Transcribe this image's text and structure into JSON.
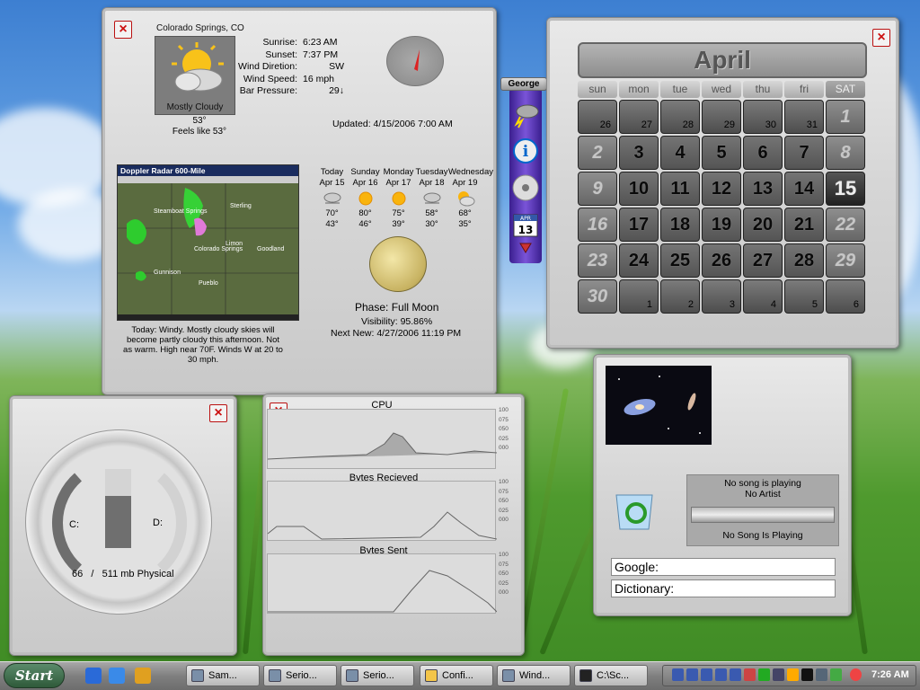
{
  "weather": {
    "city": "Colorado Springs, CO",
    "condition": "Mostly Cloudy",
    "temp": "53°",
    "feels": "Feels like 53°",
    "stats": [
      {
        "label": "Sunrise:",
        "value": "6:23 AM"
      },
      {
        "label": "Sunset:",
        "value": "7:37 PM"
      },
      {
        "label": "Wind Diretion:",
        "value": "SW"
      },
      {
        "label": "Wind Speed:",
        "value": "16  mph"
      },
      {
        "label": "Bar Pressure:",
        "value": "29↓"
      }
    ],
    "updated": "Updated: 4/15/2006 7:00 AM",
    "radar_title": "Doppler Radar 600-Mile",
    "radar_labels": [
      "Steamboat Springs",
      "Colorado Springs",
      "Pueblo",
      "Limon",
      "Goodland",
      "Sterling",
      "Gunnison"
    ],
    "forecast": [
      {
        "day": "Today",
        "date": "Apr 15",
        "hi": "70°",
        "lo": "43°",
        "icon": "windy-icon"
      },
      {
        "day": "Sunday",
        "date": "Apr 16",
        "hi": "80°",
        "lo": "46°",
        "icon": "sun-icon"
      },
      {
        "day": "Monday",
        "date": "Apr 17",
        "hi": "75°",
        "lo": "39°",
        "icon": "sun-icon"
      },
      {
        "day": "Tuesday",
        "date": "Apr 18",
        "hi": "58°",
        "lo": "30°",
        "icon": "windy-icon"
      },
      {
        "day": "Wednesday",
        "date": "Apr 19",
        "hi": "68°",
        "lo": "35°",
        "icon": "partly-sunny-icon"
      }
    ],
    "phase": "Phase: Full Moon",
    "visibility": "Visibility: 95.86%",
    "next_new": "Next New: 4/27/2006 11:19 PM",
    "text_forecast": "Today: Windy. Mostly cloudy skies will become partly cloudy this afternoon. Not as warm. High near 70F. Winds W at 20 to 30 mph."
  },
  "sidebar": {
    "user": "George",
    "calendar_icon_month": "APR",
    "calendar_icon_day": "13"
  },
  "calendar": {
    "month": "April",
    "dow": [
      "sun",
      "mon",
      "tue",
      "wed",
      "thu",
      "fri",
      "SAT"
    ],
    "prev": [
      "26",
      "27",
      "28",
      "29",
      "30",
      "31"
    ],
    "days": [
      "1",
      "2",
      "3",
      "4",
      "5",
      "6",
      "7",
      "8",
      "9",
      "10",
      "11",
      "12",
      "13",
      "14",
      "15",
      "16",
      "17",
      "18",
      "19",
      "20",
      "21",
      "22",
      "23",
      "24",
      "25",
      "26",
      "27",
      "28",
      "29",
      "30"
    ],
    "next": [
      "1",
      "2",
      "3",
      "4",
      "5",
      "6"
    ],
    "today": "15"
  },
  "drives": {
    "c_label": "C:",
    "d_label": "D:",
    "memory_used": "66",
    "memory_sep": "/",
    "memory_total": "511 mb Physical",
    "c_fill": 0.66
  },
  "network": {
    "graphs": [
      {
        "title": "CPU",
        "ticks": [
          "100",
          "075",
          "050",
          "025",
          "000"
        ]
      },
      {
        "title": "Bytes Recieved",
        "ticks": [
          "100",
          "075",
          "050",
          "025",
          "000"
        ]
      },
      {
        "title": "Bytes Sent",
        "ticks": [
          "100",
          "075",
          "050",
          "025",
          "000"
        ]
      }
    ]
  },
  "media": {
    "line1": "No song is playing",
    "line2": "No Artist",
    "line3": "No Song Is Playing",
    "google_label": "Google:",
    "dictionary_label": "Dictionary:"
  },
  "taskbar": {
    "start": "Start",
    "tasks": [
      "Sam...",
      "Serio...",
      "Serio...",
      "Confi...",
      "Wind...",
      "C:\\Sc..."
    ],
    "clock": "7:26 AM"
  }
}
